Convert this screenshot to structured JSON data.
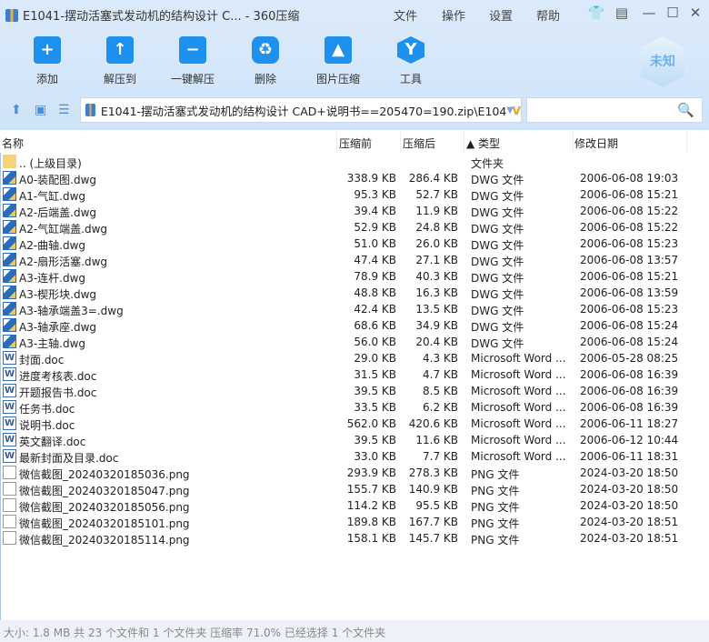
{
  "window": {
    "title": "E1041-摆动活塞式发动机的结构设计 C... - 360压缩"
  },
  "menu": [
    "文件",
    "操作",
    "设置",
    "帮助"
  ],
  "toolbar": [
    {
      "label": "添加",
      "glyph": "+"
    },
    {
      "label": "解压到",
      "glyph": "↑"
    },
    {
      "label": "一键解压",
      "glyph": "−"
    },
    {
      "label": "删除",
      "glyph": "♻"
    },
    {
      "label": "图片压缩",
      "glyph": "▲"
    },
    {
      "label": "工具",
      "glyph": "Y"
    }
  ],
  "badge": "未知",
  "address": {
    "path": "E1041-摆动活塞式发动机的结构设计 CAD+说明书==205470=190.zip\\E104"
  },
  "search": {
    "placeholder": ""
  },
  "columns": {
    "name": "名称",
    "before": "压缩前",
    "after": "压缩后",
    "type": "▲ 类型",
    "date": "修改日期"
  },
  "files": [
    {
      "icon": "folder",
      "name": ".. (上级目录)",
      "before": "",
      "after": "",
      "type": "文件夹",
      "date": ""
    },
    {
      "icon": "dwg",
      "name": "A0-装配图.dwg",
      "before": "338.9 KB",
      "after": "286.4 KB",
      "type": "DWG 文件",
      "date": "2006-06-08 19:03"
    },
    {
      "icon": "dwg",
      "name": "A1-气缸.dwg",
      "before": "95.3 KB",
      "after": "52.7 KB",
      "type": "DWG 文件",
      "date": "2006-06-08 15:21"
    },
    {
      "icon": "dwg",
      "name": "A2-后端盖.dwg",
      "before": "39.4 KB",
      "after": "11.9 KB",
      "type": "DWG 文件",
      "date": "2006-06-08 15:22"
    },
    {
      "icon": "dwg",
      "name": "A2-气缸端盖.dwg",
      "before": "52.9 KB",
      "after": "24.8 KB",
      "type": "DWG 文件",
      "date": "2006-06-08 15:22"
    },
    {
      "icon": "dwg",
      "name": "A2-曲轴.dwg",
      "before": "51.0 KB",
      "after": "26.0 KB",
      "type": "DWG 文件",
      "date": "2006-06-08 15:23"
    },
    {
      "icon": "dwg",
      "name": "A2-扇形活塞.dwg",
      "before": "47.4 KB",
      "after": "27.1 KB",
      "type": "DWG 文件",
      "date": "2006-06-08 13:57"
    },
    {
      "icon": "dwg",
      "name": "A3-连杆.dwg",
      "before": "78.9 KB",
      "after": "40.3 KB",
      "type": "DWG 文件",
      "date": "2006-06-08 15:21"
    },
    {
      "icon": "dwg",
      "name": "A3-楔形块.dwg",
      "before": "48.8 KB",
      "after": "16.3 KB",
      "type": "DWG 文件",
      "date": "2006-06-08 13:59"
    },
    {
      "icon": "dwg",
      "name": "A3-轴承端盖3=.dwg",
      "before": "42.4 KB",
      "after": "13.5 KB",
      "type": "DWG 文件",
      "date": "2006-06-08 15:23"
    },
    {
      "icon": "dwg",
      "name": "A3-轴承座.dwg",
      "before": "68.6 KB",
      "after": "34.9 KB",
      "type": "DWG 文件",
      "date": "2006-06-08 15:24"
    },
    {
      "icon": "dwg",
      "name": "A3-主轴.dwg",
      "before": "56.0 KB",
      "after": "20.4 KB",
      "type": "DWG 文件",
      "date": "2006-06-08 15:24"
    },
    {
      "icon": "doc",
      "name": "封面.doc",
      "before": "29.0 KB",
      "after": "4.3 KB",
      "type": "Microsoft Word ...",
      "date": "2006-05-28 08:25"
    },
    {
      "icon": "doc",
      "name": "进度考核表.doc",
      "before": "31.5 KB",
      "after": "4.7 KB",
      "type": "Microsoft Word ...",
      "date": "2006-06-08 16:39"
    },
    {
      "icon": "doc",
      "name": "开题报告书.doc",
      "before": "39.5 KB",
      "after": "8.5 KB",
      "type": "Microsoft Word ...",
      "date": "2006-06-08 16:39"
    },
    {
      "icon": "doc",
      "name": "任务书.doc",
      "before": "33.5 KB",
      "after": "6.2 KB",
      "type": "Microsoft Word ...",
      "date": "2006-06-08 16:39"
    },
    {
      "icon": "doc",
      "name": "说明书.doc",
      "before": "562.0 KB",
      "after": "420.6 KB",
      "type": "Microsoft Word ...",
      "date": "2006-06-11 18:27"
    },
    {
      "icon": "doc",
      "name": "英文翻译.doc",
      "before": "39.5 KB",
      "after": "11.6 KB",
      "type": "Microsoft Word ...",
      "date": "2006-06-12 10:44"
    },
    {
      "icon": "doc",
      "name": "最新封面及目录.doc",
      "before": "33.0 KB",
      "after": "7.7 KB",
      "type": "Microsoft Word ...",
      "date": "2006-06-11 18:31"
    },
    {
      "icon": "png",
      "name": "微信截图_20240320185036.png",
      "before": "293.9 KB",
      "after": "278.3 KB",
      "type": "PNG 文件",
      "date": "2024-03-20 18:50"
    },
    {
      "icon": "png",
      "name": "微信截图_20240320185047.png",
      "before": "155.7 KB",
      "after": "140.9 KB",
      "type": "PNG 文件",
      "date": "2024-03-20 18:50"
    },
    {
      "icon": "png",
      "name": "微信截图_20240320185056.png",
      "before": "114.2 KB",
      "after": "95.5 KB",
      "type": "PNG 文件",
      "date": "2024-03-20 18:50"
    },
    {
      "icon": "png",
      "name": "微信截图_20240320185101.png",
      "before": "189.8 KB",
      "after": "167.7 KB",
      "type": "PNG 文件",
      "date": "2024-03-20 18:51"
    },
    {
      "icon": "png",
      "name": "微信截图_20240320185114.png",
      "before": "158.1 KB",
      "after": "145.7 KB",
      "type": "PNG 文件",
      "date": "2024-03-20 18:51"
    }
  ],
  "status": "大小: 1.8 MB 共 23 个文件和 1 个文件夹 压缩率 71.0% 已经选择 1 个文件夹"
}
